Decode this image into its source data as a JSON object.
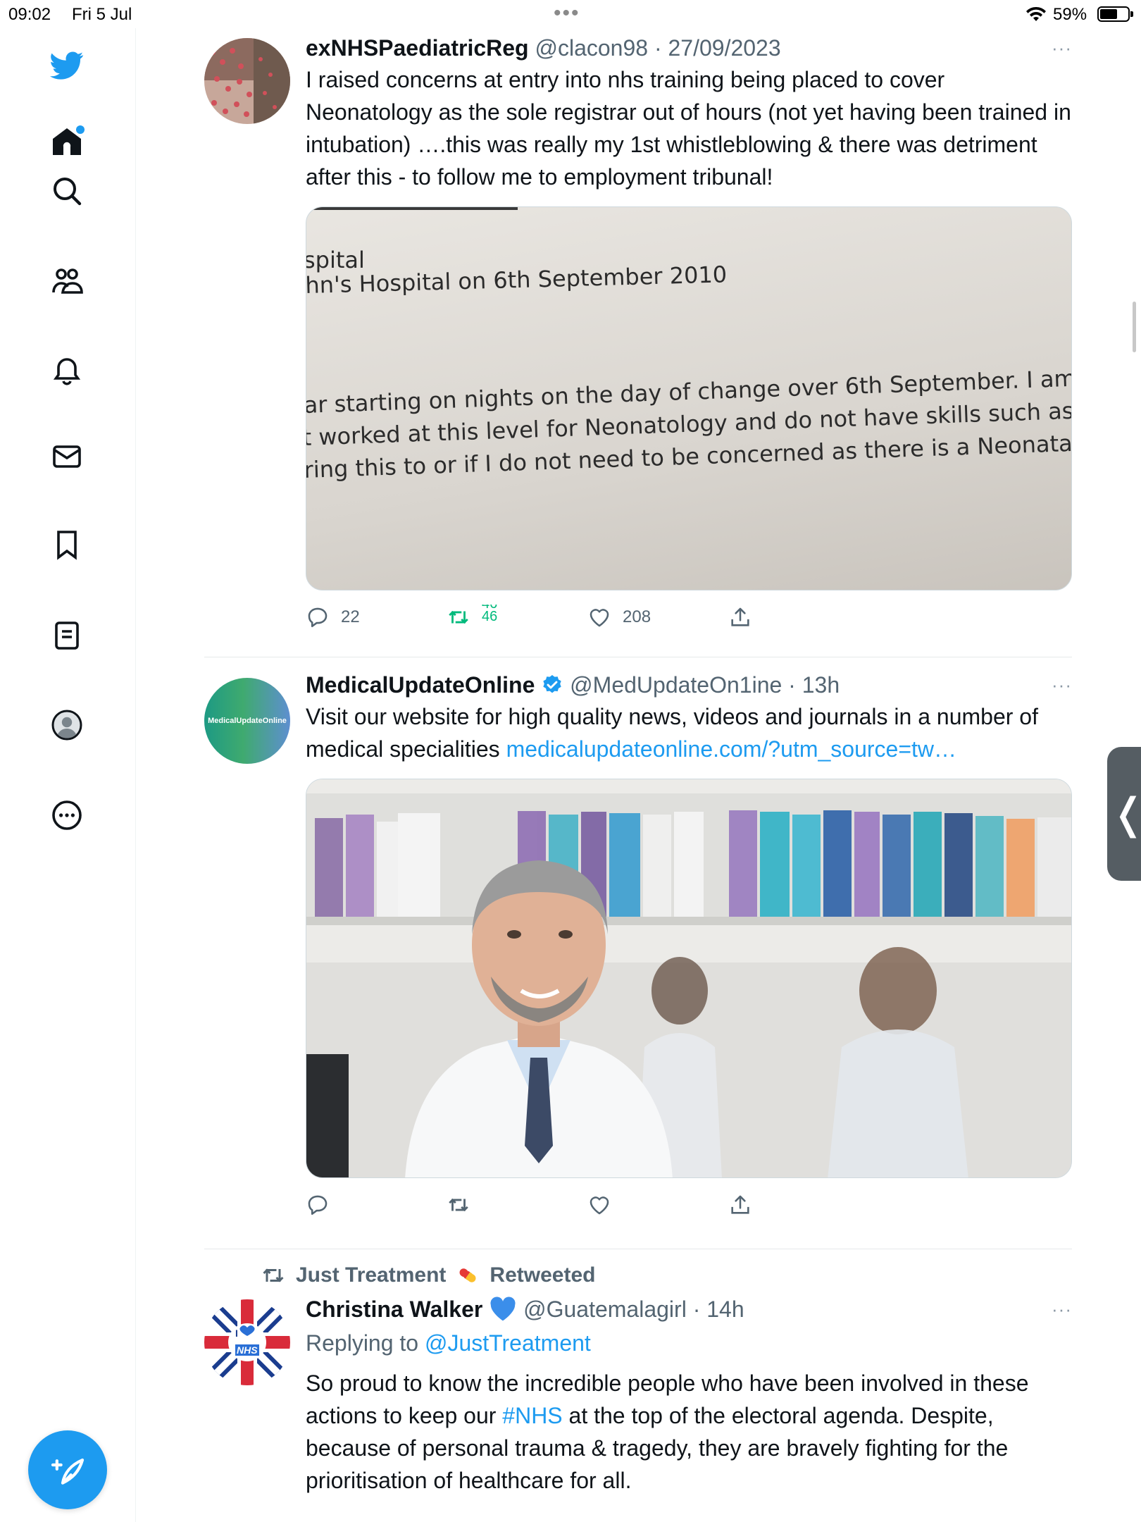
{
  "status_bar": {
    "time": "09:02",
    "date": "Fri 5 Jul",
    "battery_pct": "59%"
  },
  "sidebar": {
    "items": [
      {
        "icon": "twitter-bird-icon"
      },
      {
        "icon": "home-icon"
      },
      {
        "icon": "search-icon"
      },
      {
        "icon": "communities-icon"
      },
      {
        "icon": "bell-icon"
      },
      {
        "icon": "mail-icon"
      },
      {
        "icon": "bookmark-icon"
      },
      {
        "icon": "lists-icon"
      },
      {
        "icon": "profile-icon"
      },
      {
        "icon": "more-circle-icon"
      }
    ],
    "compose_icon": "compose-icon"
  },
  "colors": {
    "accent": "#1d9bf0",
    "retweet_green": "#00ba7c",
    "secondary_text": "#536471"
  },
  "tweets": [
    {
      "name": "exNHSPaediatricReg",
      "handle": "@clacon98 · 27/09/2023",
      "more": "···",
      "text": "I raised concerns at entry into nhs training being placed to cover Neonatology as the sole registrar out of hours (not yet having been trained in intubation) ….this was really my 1st whistleblowing & there was detriment after this - to follow me to employment tribunal!",
      "image_lines": [
        "spital",
        "hn's Hospital on 6th September 2010",
        "ar starting on nights on the day of change over 6th September. I am",
        "t worked at this level for Neonatology and do not have skills such as",
        "ring this to or if I do not need to be concerned as there is a Neonata"
      ],
      "replies": "22",
      "retweets_top": "46",
      "retweets_bottom": "46",
      "likes": "208"
    },
    {
      "name": "MedicalUpdateOnline",
      "handle": "@MedUpdateOn1ine · 13h",
      "more": "···",
      "avatar_label": "MedicalUpdateOnline",
      "text": "Visit our website for high quality news, videos and journals in a number of medical specialities ",
      "link": "medicalupdateonline.com/?utm_source=tw…"
    },
    {
      "context_name": "Just Treatment",
      "context_suffix": "Retweeted",
      "name": "Christina Walker",
      "handle": "@Guatemalagirl · 14h",
      "more": "···",
      "avatar_label_top": "I",
      "avatar_label_bottom": "NHS",
      "replying_prefix": "Replying to ",
      "replying_handle": "@JustTreatment",
      "text_part1": "So proud to know the incredible people who have been involved in these actions to keep our ",
      "hashtag": "#NHS",
      "text_part2": " at the top of the electoral agenda. Despite, because of personal trauma & tragedy, they are bravely fighting for the prioritisation of healthcare for all."
    }
  ]
}
